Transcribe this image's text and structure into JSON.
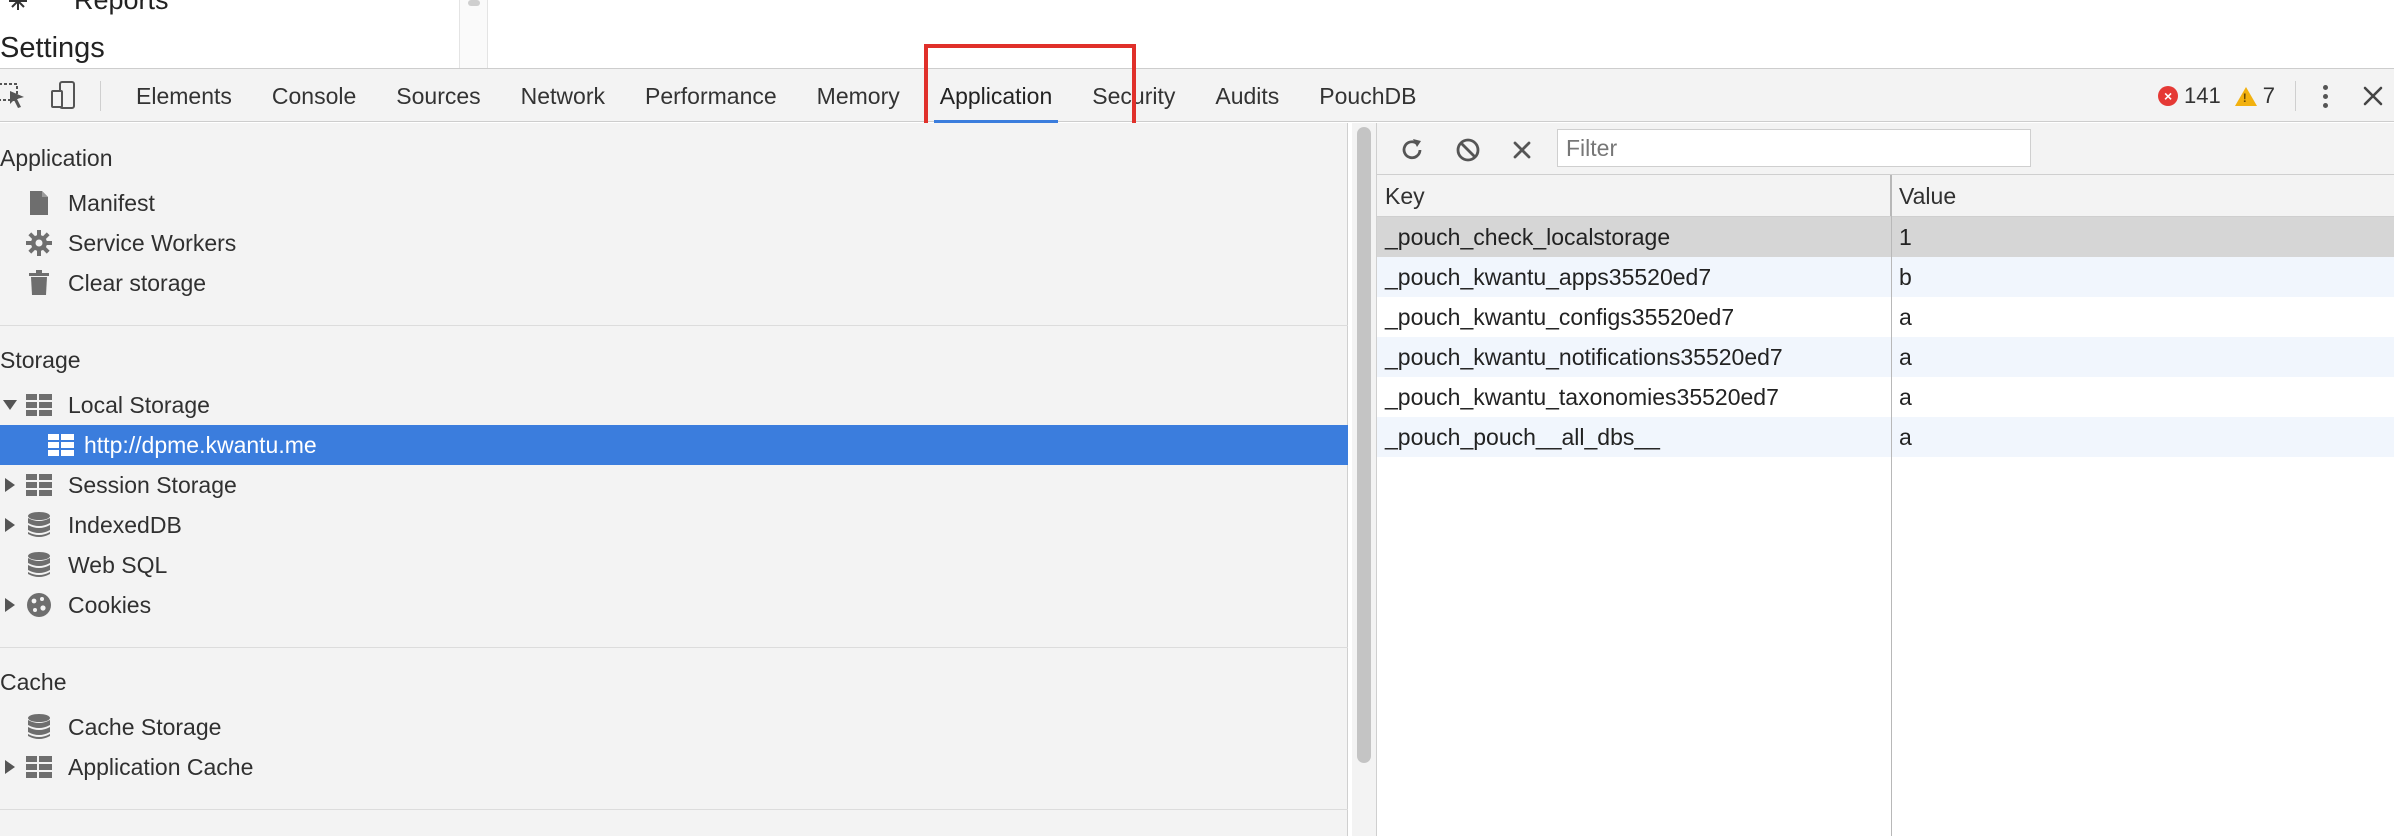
{
  "page": {
    "reports_label": "Reports",
    "settings_label": "Settings"
  },
  "devtools": {
    "tabs": [
      {
        "label": "Elements"
      },
      {
        "label": "Console"
      },
      {
        "label": "Sources"
      },
      {
        "label": "Network"
      },
      {
        "label": "Performance"
      },
      {
        "label": "Memory"
      },
      {
        "label": "Application",
        "active": true
      },
      {
        "label": "Security"
      },
      {
        "label": "Audits"
      },
      {
        "label": "PouchDB"
      }
    ],
    "error_count": "141",
    "warning_count": "7",
    "accent_color": "#3b7ddd",
    "highlight_color": "#e0302a"
  },
  "sidebar": {
    "application": {
      "title": "Application",
      "items": [
        {
          "label": "Manifest",
          "icon": "document-icon"
        },
        {
          "label": "Service Workers",
          "icon": "gear-icon"
        },
        {
          "label": "Clear storage",
          "icon": "trash-icon"
        }
      ]
    },
    "storage": {
      "title": "Storage",
      "items": [
        {
          "label": "Local Storage",
          "icon": "table-icon",
          "expanded": true
        },
        {
          "label": "http://dpme.kwantu.me",
          "icon": "table-icon",
          "selected": true
        },
        {
          "label": "Session Storage",
          "icon": "table-icon"
        },
        {
          "label": "IndexedDB",
          "icon": "database-icon"
        },
        {
          "label": "Web SQL",
          "icon": "database-icon"
        },
        {
          "label": "Cookies",
          "icon": "cookie-icon"
        }
      ]
    },
    "cache": {
      "title": "Cache",
      "items": [
        {
          "label": "Cache Storage",
          "icon": "database-icon"
        },
        {
          "label": "Application Cache",
          "icon": "table-icon"
        }
      ]
    }
  },
  "storage_view": {
    "filter_placeholder": "Filter",
    "columns": {
      "key": "Key",
      "value": "Value"
    },
    "rows": [
      {
        "key": "_pouch_check_localstorage",
        "value": "1"
      },
      {
        "key": "_pouch_kwantu_apps35520ed7",
        "value": "b"
      },
      {
        "key": "_pouch_kwantu_configs35520ed7",
        "value": "a"
      },
      {
        "key": "_pouch_kwantu_notifications35520ed7",
        "value": "a"
      },
      {
        "key": "_pouch_kwantu_taxonomies35520ed7",
        "value": "a"
      },
      {
        "key": "_pouch_pouch__all_dbs__",
        "value": "a"
      }
    ]
  }
}
